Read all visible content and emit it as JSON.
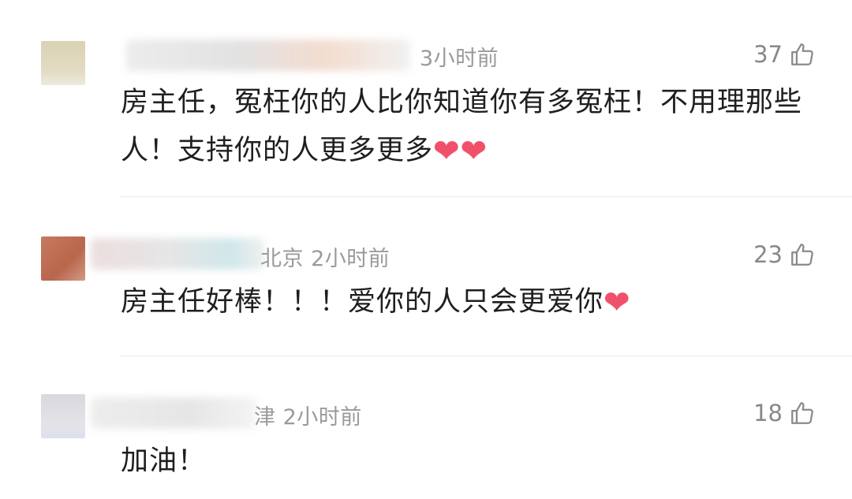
{
  "comments": [
    {
      "meta": "3小时前",
      "likes": "37",
      "text": "房主任，冤枉你的人比你知道你有多冤枉！不用理那些人！支持你的人更多更多",
      "hearts": [
        "❤",
        "❤"
      ]
    },
    {
      "meta": "北京 2小时前",
      "likes": "23",
      "text": "房主任好棒！！！爱你的人只会更爱你",
      "hearts": [
        "❤"
      ]
    },
    {
      "meta": "津 2小时前",
      "likes": "18",
      "text": "加油！",
      "hearts": []
    }
  ],
  "icons": {
    "like": "thumbs-up-icon",
    "heart": "red-heart-emoji"
  },
  "colors": {
    "meta_text": "#9a9a9a",
    "like_text": "#888888",
    "heart": "#f0506a"
  }
}
